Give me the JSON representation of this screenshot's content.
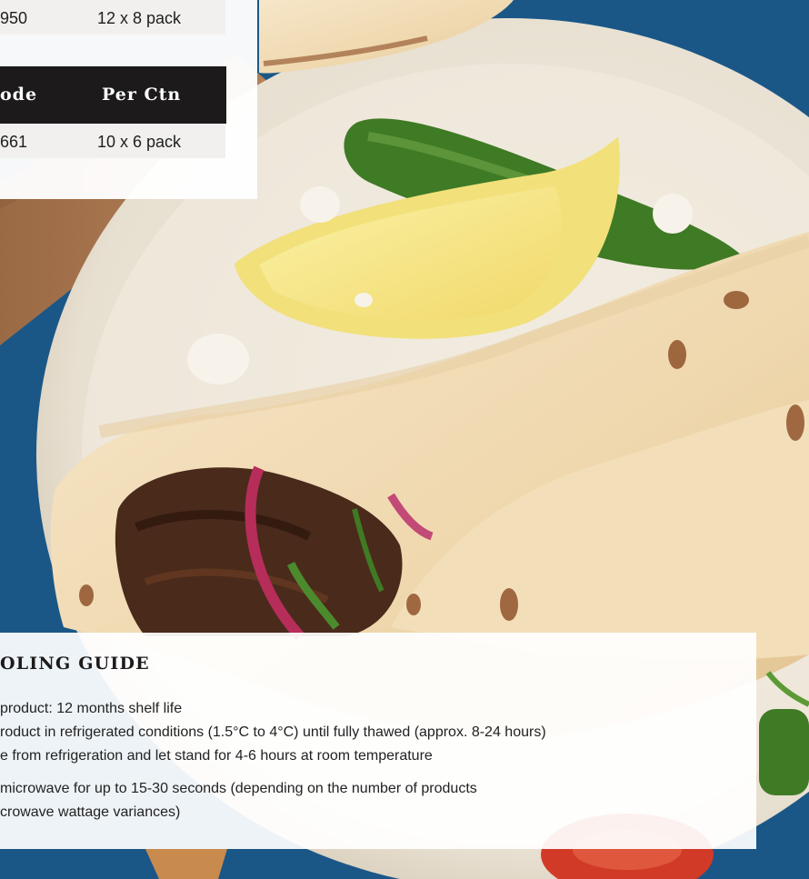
{
  "product_table": {
    "top_row": {
      "code": "950",
      "per_ctn": "12 x 8 pack"
    },
    "header": {
      "code_label": "ode",
      "per_ctn_label": "Per Ctn"
    },
    "bottom_row": {
      "code": "661",
      "per_ctn": "10 x 6 pack"
    }
  },
  "handling_guide": {
    "title": "OLING GUIDE",
    "lines": [
      "product: 12 months shelf life",
      "roduct in refrigerated conditions (1.5°C to 4°C) until fully thawed (approx. 8-24 hours)",
      "e from refrigeration and let stand for 4-6 hours at room temperature",
      "microwave for up to 15-30 seconds (depending on the number of products",
      "crowave wattage variances)"
    ]
  },
  "colors": {
    "header_bg": "#1c1a1b",
    "row_bg": "#f1f0ee",
    "background_blue": "#1d5c8e"
  }
}
